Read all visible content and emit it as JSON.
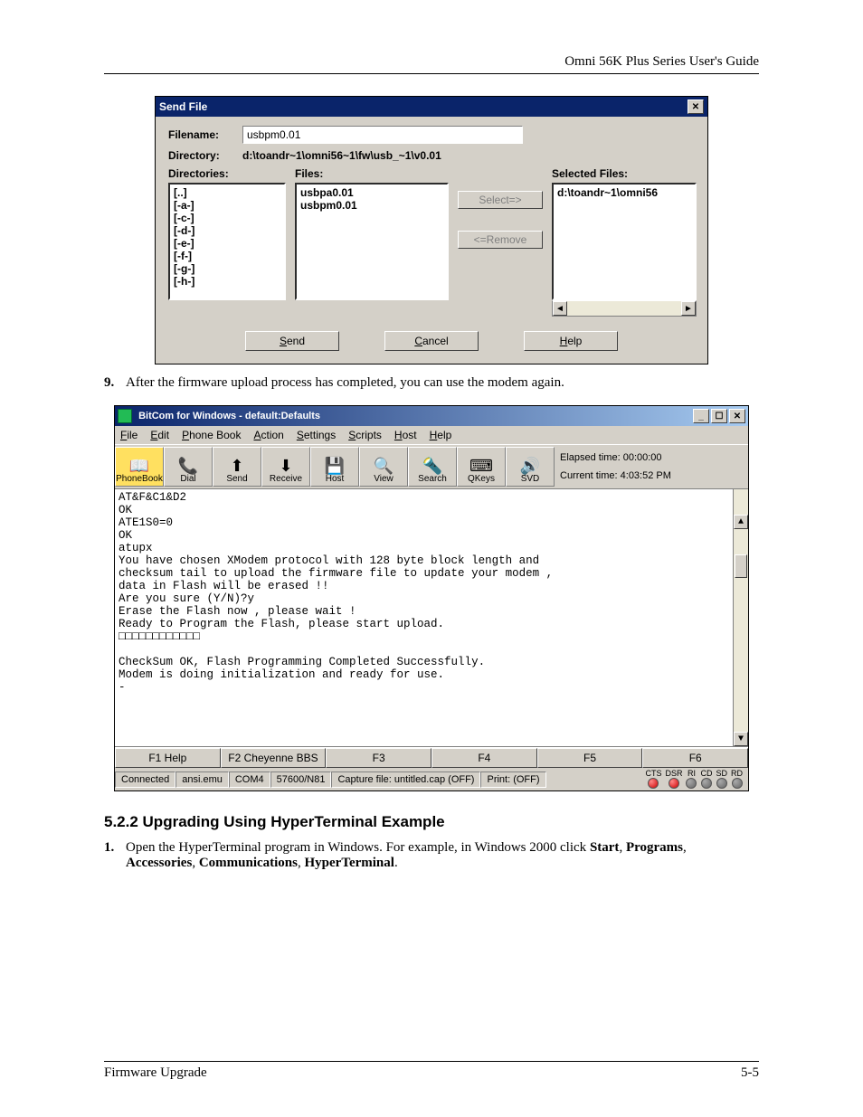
{
  "header": {
    "right": "Omni 56K Plus Series User's Guide"
  },
  "footer": {
    "left": "Firmware Upgrade",
    "right": "5-5"
  },
  "sendDialog": {
    "title": "Send File",
    "labels": {
      "filename": "Filename:",
      "directory": "Directory:",
      "directories": "Directories:",
      "files": "Files:",
      "selectedFiles": "Selected Files:"
    },
    "filename": "usbpm0.01",
    "directory": "d:\\toandr~1\\omni56~1\\fw\\usb_~1\\v0.01",
    "dirList": [
      "[..]",
      "[-a-]",
      "[-c-]",
      "[-d-]",
      "[-e-]",
      "[-f-]",
      "[-g-]",
      "[-h-]"
    ],
    "fileList": [
      "usbpa0.01",
      "usbpm0.01"
    ],
    "selectedList": [
      "d:\\toandr~1\\omni56"
    ],
    "buttons": {
      "select": "Select=>",
      "remove": "<=Remove",
      "send": "Send",
      "cancel": "Cancel",
      "help": "Help"
    }
  },
  "step9": {
    "num": "9.",
    "text": "After the firmware upload process has completed, you can use the modem again."
  },
  "bitcom": {
    "title": "BitCom for Windows - default:Defaults",
    "menu": [
      "File",
      "Edit",
      "Phone Book",
      "Action",
      "Settings",
      "Scripts",
      "Host",
      "Help"
    ],
    "toolbar": [
      {
        "name": "phonebook",
        "label": "PhoneBook",
        "icon": "📖"
      },
      {
        "name": "dial",
        "label": "Dial",
        "icon": "📞"
      },
      {
        "name": "send",
        "label": "Send",
        "icon": "⬆"
      },
      {
        "name": "receive",
        "label": "Receive",
        "icon": "⬇"
      },
      {
        "name": "host",
        "label": "Host",
        "icon": "💾"
      },
      {
        "name": "view",
        "label": "View",
        "icon": "🔍"
      },
      {
        "name": "search",
        "label": "Search",
        "icon": "🔦"
      },
      {
        "name": "qkeys",
        "label": "QKeys",
        "icon": "⌨"
      },
      {
        "name": "svd",
        "label": "SVD",
        "icon": "🔊"
      }
    ],
    "times": {
      "elapsed_lbl": "Elapsed time:",
      "elapsed": "00:00:00",
      "current_lbl": "Current time:",
      "current": "4:03:52 PM"
    },
    "terminal": "AT&F&C1&D2\nOK\nATE1S0=0\nOK\natupx\nYou have chosen XModem protocol with 128 byte block length and\nchecksum tail to upload the firmware file to update your modem ,\ndata in Flash will be erased !!\nAre you sure (Y/N)?y\nErase the Flash now , please wait !\nReady to Program the Flash, please start upload.\n□□□□□□□□□□□□\n\nCheckSum OK, Flash Programming Completed Successfully.\nModem is doing initialization and ready for use.\n-",
    "fkeys": [
      "F1 Help",
      "F2 Cheyenne BBS",
      "F3",
      "F4",
      "F5",
      "F6"
    ],
    "status": {
      "conn": "Connected",
      "emu": "ansi.emu",
      "port": "COM4",
      "speed": "57600/N81",
      "capture": "Capture file: untitled.cap (OFF)",
      "print": "Print: (OFF)"
    },
    "leds": [
      {
        "label": "CTS",
        "on": true
      },
      {
        "label": "DSR",
        "on": true
      },
      {
        "label": "RI",
        "on": false
      },
      {
        "label": "CD",
        "on": false
      },
      {
        "label": "SD",
        "on": false
      },
      {
        "label": "RD",
        "on": false
      }
    ]
  },
  "section": {
    "heading": "5.2.2   Upgrading Using HyperTerminal Example",
    "step1": {
      "num": "1.",
      "text_a": "Open the HyperTerminal program in Windows. For example, in Windows 2000 click ",
      "bold1": "Start",
      "sep1": ", ",
      "bold2": "Programs",
      "sep2": ", ",
      "bold3": "Accessories",
      "sep3": ", ",
      "bold4": "Communications",
      "sep4": ", ",
      "bold5": "HyperTerminal",
      "end": "."
    }
  }
}
